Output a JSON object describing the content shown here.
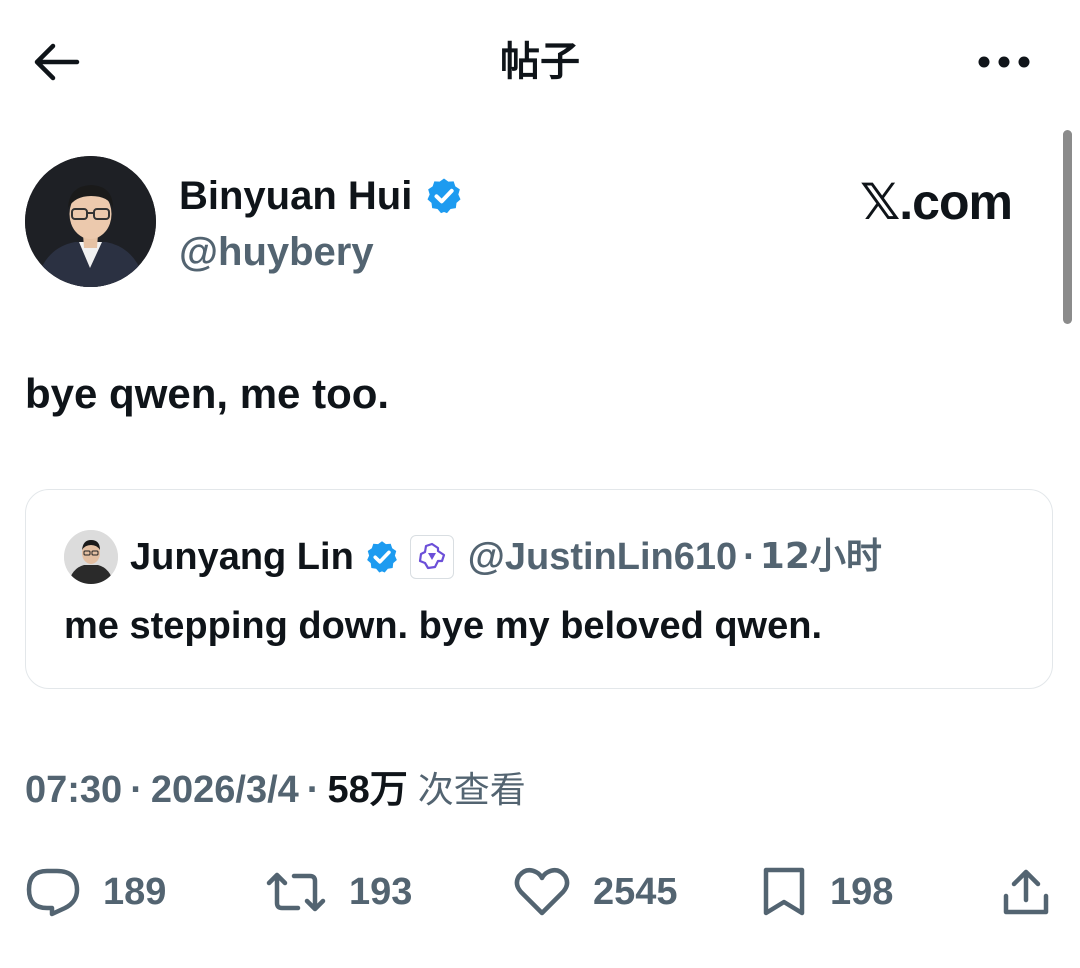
{
  "header": {
    "title": "帖子",
    "back_icon": "arrow-left-icon",
    "more_icon": "more-horizontal-icon"
  },
  "tweet": {
    "author": {
      "name": "Binyuan Hui",
      "handle": "@huybery",
      "verified": true
    },
    "watermark": "𝕏.com",
    "text": "bye qwen, me too.",
    "timestamp": {
      "time": "07:30",
      "date": "2026/3/4",
      "views": "58万",
      "views_label": "次查看",
      "separator": "·"
    }
  },
  "quote": {
    "author_name": "Junyang Lin",
    "handle": "@JustinLin610",
    "separator": "·",
    "relative_time": "12小时",
    "verified": true,
    "text": "me stepping down. bye my beloved qwen."
  },
  "actions": {
    "replies": "189",
    "reposts": "193",
    "likes": "2545",
    "bookmarks": "198",
    "icons": [
      "reply-icon",
      "repost-icon",
      "like-icon",
      "bookmark-icon",
      "share-icon"
    ]
  },
  "colors": {
    "text_primary": "#0f1419",
    "text_secondary": "#536471",
    "verified_blue": "#1d9bf0",
    "border": "#e3e7ea"
  }
}
